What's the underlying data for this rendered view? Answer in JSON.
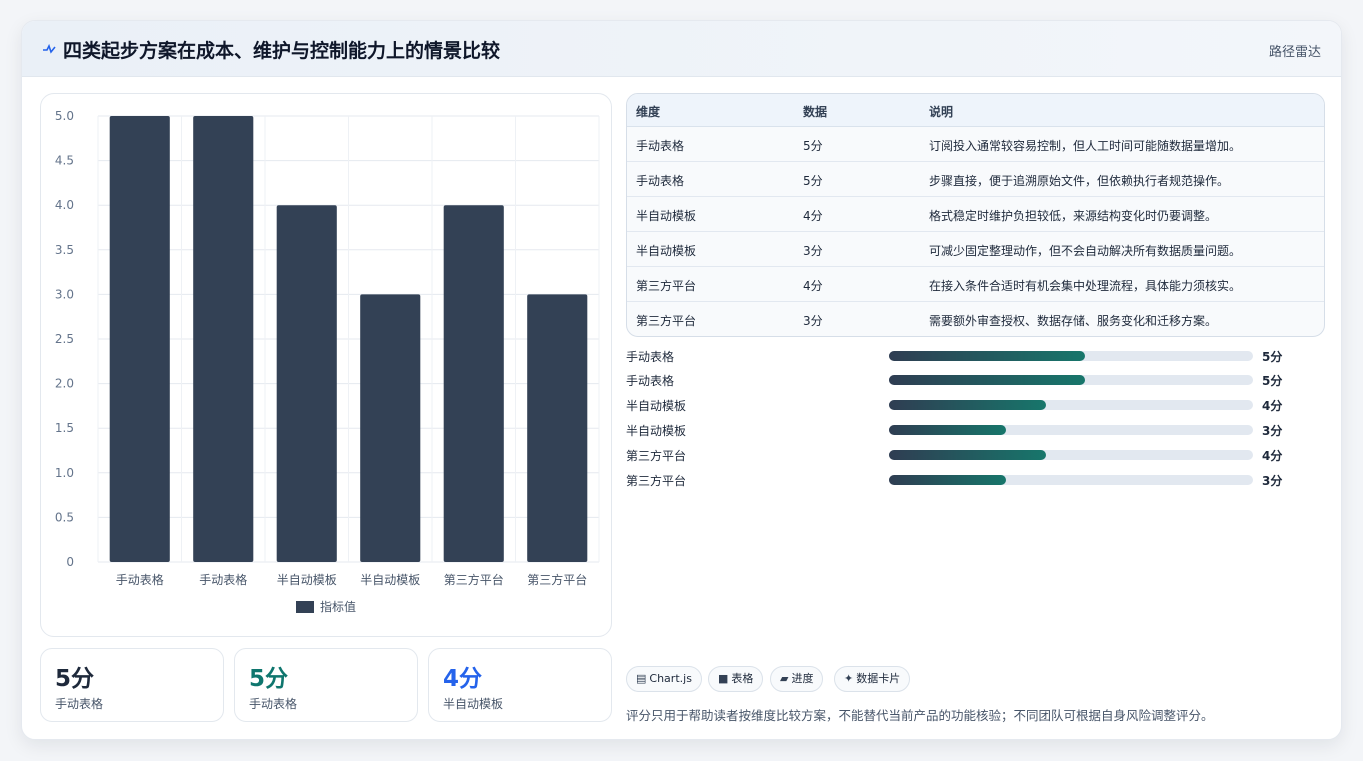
{
  "header": {
    "title": "四类起步方案在成本、维护与控制能力上的情景比较",
    "tag": "路径雷达"
  },
  "colors": {
    "bar": "#334155",
    "accent_teal": "#17766b",
    "accent_blue": "#2563eb",
    "accent_dark": "#1e293b"
  },
  "chart_data": {
    "type": "bar",
    "categories": [
      "手动表格",
      "手动表格",
      "半自动模板",
      "半自动模板",
      "第三方平台",
      "第三方平台"
    ],
    "series": [
      {
        "name": "指标值",
        "values": [
          5,
          5,
          4,
          3,
          4,
          3
        ]
      }
    ],
    "ylim": [
      0,
      5
    ],
    "yticks": [
      "0",
      "0.5",
      "1.0",
      "1.5",
      "2.0",
      "2.5",
      "3.0",
      "3.5",
      "4.0",
      "4.5",
      "5.0"
    ],
    "grid": true,
    "legend": "bottom"
  },
  "stats": [
    {
      "value": "5分",
      "label": "手动表格",
      "color": "#1e293b"
    },
    {
      "value": "5分",
      "label": "手动表格",
      "color": "#0f766e"
    },
    {
      "value": "4分",
      "label": "半自动模板",
      "color": "#2563eb"
    }
  ],
  "table": {
    "headers": [
      "维度",
      "数据",
      "说明"
    ],
    "rows": [
      [
        "手动表格",
        "5分",
        "订阅投入通常较容易控制，但人工时间可能随数据量增加。"
      ],
      [
        "手动表格",
        "5分",
        "步骤直接，便于追溯原始文件，但依赖执行者规范操作。"
      ],
      [
        "半自动模板",
        "4分",
        "格式稳定时维护负担较低，来源结构变化时仍要调整。"
      ],
      [
        "半自动模板",
        "3分",
        "可减少固定整理动作，但不会自动解决所有数据质量问题。"
      ],
      [
        "第三方平台",
        "4分",
        "在接入条件合适时有机会集中处理流程，具体能力须核实。"
      ],
      [
        "第三方平台",
        "3分",
        "需要额外审查授权、数据存储、服务变化和迁移方案。"
      ]
    ]
  },
  "progress": [
    {
      "label": "手动表格",
      "value": 5,
      "max": 9.3,
      "text": "5分"
    },
    {
      "label": "手动表格",
      "value": 5,
      "max": 9.3,
      "text": "5分"
    },
    {
      "label": "半自动模板",
      "value": 4,
      "max": 9.3,
      "text": "4分"
    },
    {
      "label": "半自动模板",
      "value": 3,
      "max": 9.3,
      "text": "3分"
    },
    {
      "label": "第三方平台",
      "value": 4,
      "max": 9.3,
      "text": "4分"
    },
    {
      "label": "第三方平台",
      "value": 3,
      "max": 9.3,
      "text": "3分"
    }
  ],
  "chips": [
    {
      "icon": "▤",
      "label": "Chart.js"
    },
    {
      "icon": "■",
      "label": "表格"
    },
    {
      "icon": "▰",
      "label": "进度"
    },
    {
      "icon": "✦",
      "label": "数据卡片"
    }
  ],
  "note": "评分只用于帮助读者按维度比较方案，不能替代当前产品的功能核验；不同团队可根据自身风险调整评分。"
}
